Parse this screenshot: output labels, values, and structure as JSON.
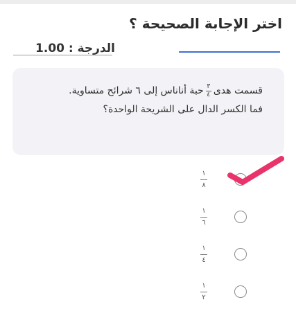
{
  "header": {
    "title": "اختر الإجابة الصحيحة ؟",
    "grade_text": "الدرجة : 1.00"
  },
  "question": {
    "before_fraction": "قسمت هدى",
    "fraction": {
      "numerator": "٣",
      "denominator": "٤"
    },
    "after_fraction": "حبة أناناس إلى ٦ شرائح متساوية. فما الكسر الدال على الشريحة الواحدة؟"
  },
  "options": [
    {
      "numerator": "١",
      "denominator": "٨"
    },
    {
      "numerator": "١",
      "denominator": "٦"
    },
    {
      "numerator": "١",
      "denominator": "٤"
    },
    {
      "numerator": "١",
      "denominator": "٢"
    }
  ],
  "colors": {
    "accent_underline": "#3b72d1",
    "annotation_mark": "#e8336b"
  },
  "icons": {
    "annotation": "check-mark-icon"
  }
}
